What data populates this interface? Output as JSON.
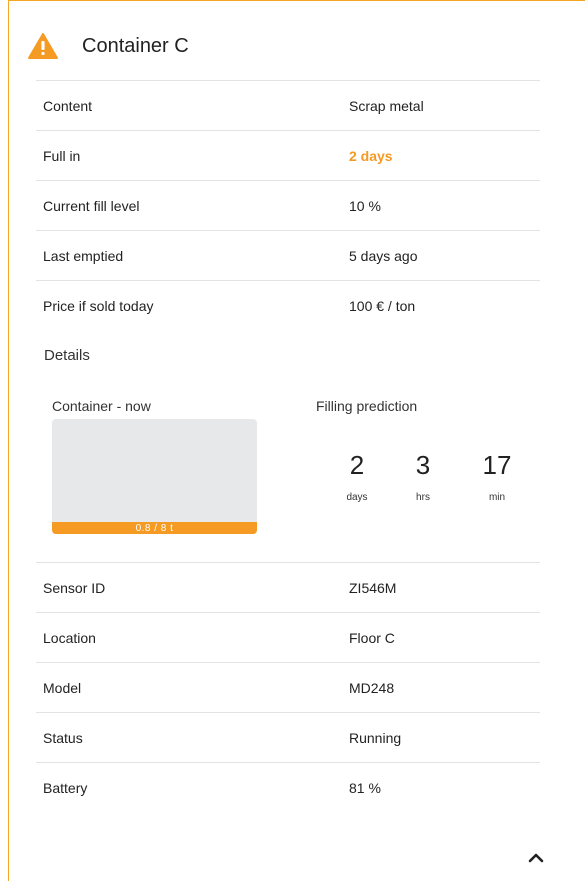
{
  "title": "Container C",
  "info_rows": [
    {
      "label": "Content",
      "value": "Scrap metal"
    },
    {
      "label": "Full in",
      "value": "2 days"
    },
    {
      "label": "Current fill level",
      "value": "10 %"
    },
    {
      "label": "Last emptied",
      "value": "5 days ago"
    },
    {
      "label": "Price if sold today",
      "value": "100 € / ton"
    }
  ],
  "details": {
    "heading": "Details",
    "container_now_label": "Container - now",
    "fill_bar_text": "0.8 / 8 t",
    "fill_fraction": 0.1,
    "prediction_label": "Filling prediction",
    "countdown": [
      {
        "value": "2",
        "unit": "days"
      },
      {
        "value": "3",
        "unit": "hrs"
      },
      {
        "value": "17",
        "unit": "min"
      }
    ]
  },
  "sensor_rows": [
    {
      "label": "Sensor ID",
      "value": "ZI546M"
    },
    {
      "label": "Location",
      "value": "Floor C"
    },
    {
      "label": "Model",
      "value": "MD248"
    },
    {
      "label": "Status",
      "value": "Running"
    },
    {
      "label": "Battery",
      "value": "81 %"
    }
  ],
  "icons": {
    "warning": "warning-icon",
    "collapse": "chevron-up-icon"
  },
  "colors": {
    "accent": "#f59a23",
    "divider": "#e3e3e3",
    "container_bg": "#e6e8ea"
  }
}
